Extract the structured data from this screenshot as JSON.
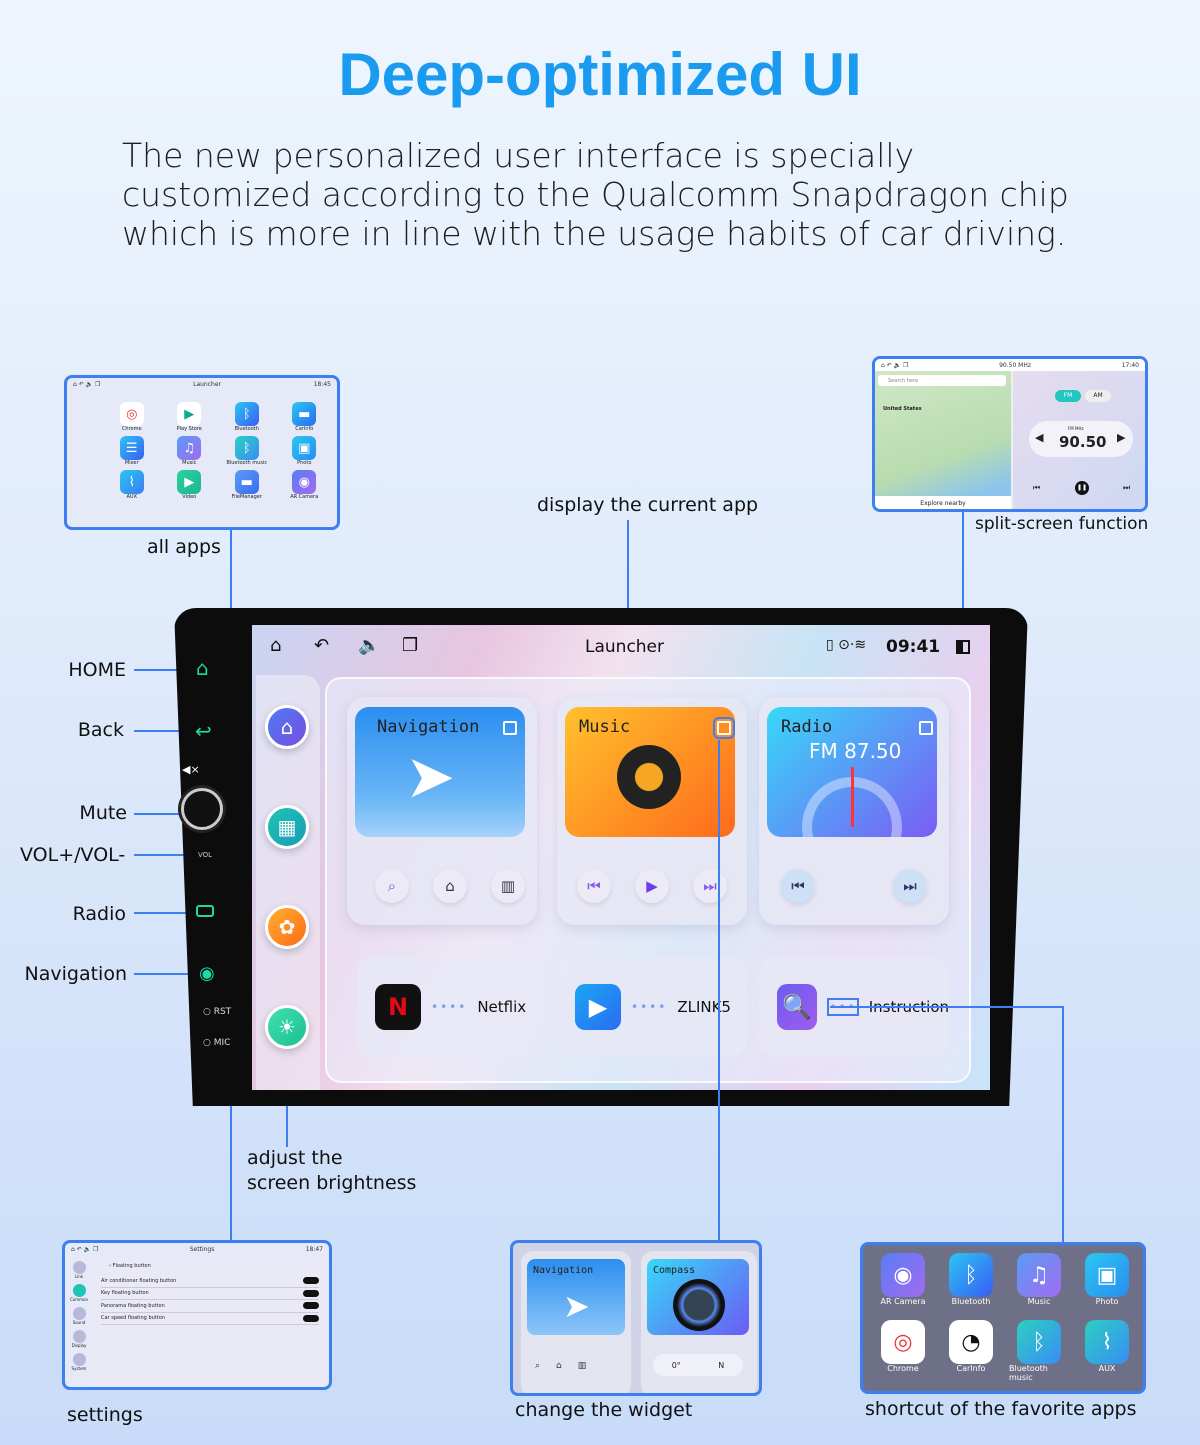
{
  "colors": {
    "accent": "#1a9bf0",
    "callout": "#3d7ff0"
  },
  "title": "Deep-optimized UI",
  "description": "The new personalized user interface is specially customized according to the Qualcomm Snapdragon chip which is more in line with the usage habits of car driving.",
  "callouts": {
    "all_apps": "all apps",
    "current_app": "display the current app",
    "split_screen": "split-screen function",
    "brightness": "adjust the\nscreen brightness",
    "settings": "settings",
    "widget": "change the widget",
    "shortcut": "shortcut of the favorite apps"
  },
  "side_labels": [
    "HOME",
    "Back",
    "Mute",
    "VOL+/VOL-",
    "Radio",
    "Navigation"
  ],
  "device": {
    "vol_label": "VOL",
    "rst_label": "RST",
    "mic_label": "MIC"
  },
  "screen": {
    "title": "Launcher",
    "time": "09:41",
    "cards": [
      {
        "title": "Navigation"
      },
      {
        "title": "Music"
      },
      {
        "title": "Radio",
        "frequency": "FM 87.50"
      }
    ],
    "bottom_apps": [
      "Netflix",
      "ZLINK5",
      "Instruction"
    ]
  },
  "all_apps": {
    "title": "Launcher",
    "time": "18:45",
    "apps": [
      "Chrome",
      "Play Store",
      "Bluetooth",
      "CarInfo",
      "Mixer",
      "Music",
      "Bluetooth music",
      "Photo",
      "AUX",
      "Video",
      "FileManager",
      "AR Camera"
    ]
  },
  "split": {
    "freq_top": "90.50 MHz",
    "time": "17:40",
    "search": "Search here",
    "map_label": "United States",
    "explore": "Explore nearby",
    "fm": "FM",
    "am": "AM",
    "unit": "FM  MHz",
    "frequency": "90.50"
  },
  "settings": {
    "title": "Settings",
    "time": "18:47",
    "back_label": "Floating button",
    "rows": [
      "Air conditioner floating button",
      "Key floating button",
      "Panorama floating button",
      "Car speed floating button"
    ],
    "nav": [
      "Link",
      "Common",
      "Sound",
      "Display",
      "System"
    ]
  },
  "widget": {
    "nav_title": "Navigation",
    "compass_title": "Compass",
    "degrees": "0°",
    "direction": "N"
  },
  "shortcuts": [
    "AR Camera",
    "Bluetooth",
    "Music",
    "Photo",
    "Chrome",
    "CarInfo",
    "Bluetooth music",
    "AUX"
  ]
}
